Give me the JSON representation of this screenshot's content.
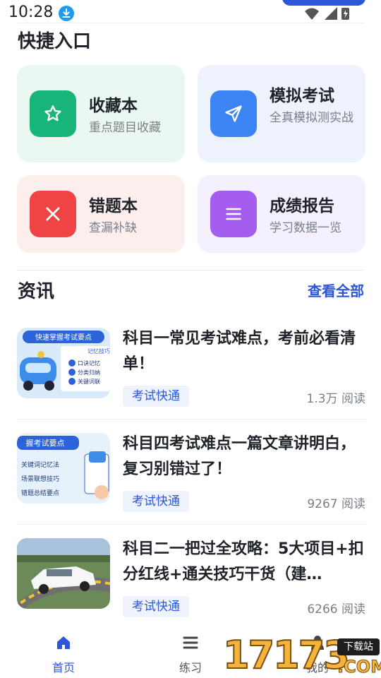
{
  "status_bar": {
    "time": "10:28"
  },
  "quick_access": {
    "title": "快捷入口",
    "cards": [
      {
        "title": "收藏本",
        "subtitle": "重点题目收藏",
        "icon": "star-icon",
        "color": "#18b57b"
      },
      {
        "title": "模拟考试",
        "subtitle": "全真模拟测实战",
        "icon": "send-icon",
        "color": "#3c84f3"
      },
      {
        "title": "错题本",
        "subtitle": "查漏补缺",
        "icon": "close-icon",
        "color": "#ef4444"
      },
      {
        "title": "成绩报告",
        "subtitle": "学习数据一览",
        "icon": "menu-icon",
        "color": "#a55df0"
      }
    ]
  },
  "news": {
    "title": "资讯",
    "view_all": "查看全部",
    "items": [
      {
        "headline": "科目一常见考试难点，考前必看清单！",
        "tag": "考试快通",
        "views": "1.3万 阅读",
        "thumb": {
          "banner": "快速掌握考试要点",
          "lines": [
            "记忆技巧",
            "口诀记忆",
            "分类归纳",
            "关键词联"
          ]
        }
      },
      {
        "headline": "科目四考试难点一篇文章讲明白，复习别错过了！",
        "tag": "考试快通",
        "views": "9267 阅读",
        "thumb": {
          "banner": "握考试要点",
          "lines": [
            "关键词记忆法",
            "场景联想技巧",
            "错题总结要点"
          ]
        }
      },
      {
        "headline": "科目二一把过全攻略：5大项目+扣分红线+通关技巧干货（建…",
        "tag": "考试快通",
        "views": "6266 阅读",
        "thumb": {
          "banner": "",
          "lines": []
        }
      }
    ]
  },
  "bottom_nav": {
    "items": [
      {
        "label": "首页",
        "icon": "home-icon",
        "active": true
      },
      {
        "label": "练习",
        "icon": "list-icon",
        "active": false
      },
      {
        "label": "我的",
        "icon": "user-icon",
        "active": false
      }
    ]
  },
  "watermark": {
    "number": "17173",
    "tag": "下载站",
    "suffix": ".COM"
  },
  "colors": {
    "accent": "#2f56d6"
  }
}
